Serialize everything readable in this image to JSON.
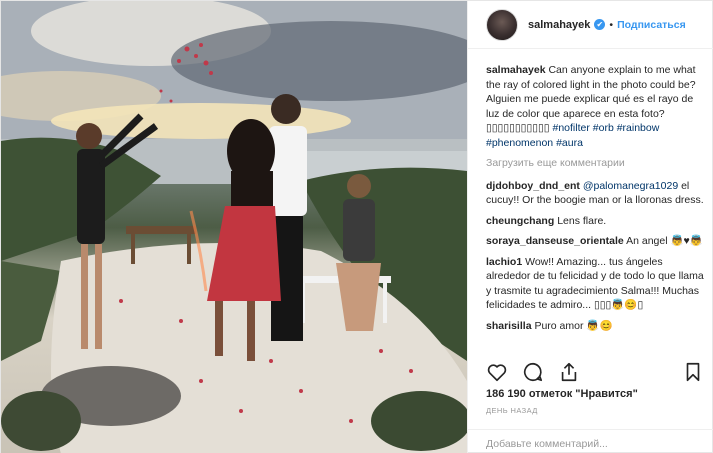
{
  "post": {
    "photo_alt": "",
    "header": {
      "username": "salmahayek",
      "verified_icon": "✔",
      "separator": "•",
      "follow_label": "Подписаться"
    },
    "caption": {
      "username": "salmahayek",
      "text": "Can anyone explain to me what the ray of colored light in the photo could be? Alguien me puede explicar qué es el rayo de luz de color que aparece en esta foto? ▯▯▯▯▯▯▯▯▯▯▯ ",
      "hashtags": [
        "#nofilter",
        "#orb",
        "#rainbow",
        "#phenomenon",
        "#aura"
      ]
    },
    "load_more": "Загрузить еще комментарии",
    "comments": [
      {
        "user": "djdohboy_dnd_ent",
        "mention": "@palomanegra1029",
        "text": " el cucuy!! Or the boogie man or la lloronas dress."
      },
      {
        "user": "cheungchang",
        "mention": "",
        "text": "Lens flare."
      },
      {
        "user": "soraya_danseuse_orientale",
        "mention": "",
        "text": "An angel 👼♥👼"
      },
      {
        "user": "lachio1",
        "mention": "",
        "text": "Wow!! Amazing... tus ángeles alrededor de tu felicidad y de todo lo que llama y trasmite tu agradecimiento Salma!!! Muchas felicidades te admiro... ▯▯▯👼😊▯"
      },
      {
        "user": "sharisilla",
        "mention": "",
        "text": "Puro amor 👼😊"
      }
    ],
    "actions": {
      "like": "heart-icon",
      "comment": "comment-icon",
      "share": "share-icon",
      "save": "bookmark-icon"
    },
    "likes_text": "186 190 отметок \"Нравится\"",
    "time_text": "день назад",
    "add_comment_placeholder": "Добавьте комментарий..."
  }
}
